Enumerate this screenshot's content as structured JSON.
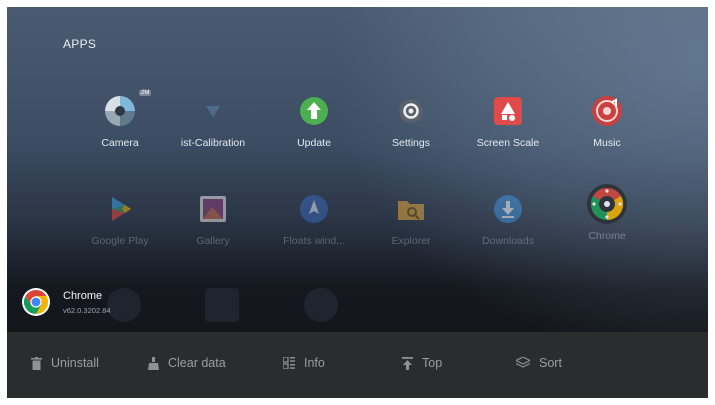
{
  "header": {
    "title": "APPS"
  },
  "apps": [
    {
      "label": "Camera",
      "badge": "2M",
      "icon": "camera-icon"
    },
    {
      "label": "ist-Calibration",
      "icon": "calibration-icon"
    },
    {
      "label": "Update",
      "icon": "update-icon"
    },
    {
      "label": "Settings",
      "icon": "settings-icon"
    },
    {
      "label": "Screen Scale",
      "icon": "screen-scale-icon"
    },
    {
      "label": "Music",
      "icon": "music-icon"
    },
    {
      "label": "Google Play",
      "icon": "play-store-icon"
    },
    {
      "label": "Gallery",
      "icon": "gallery-icon"
    },
    {
      "label": "Floats wind...",
      "icon": "float-window-icon"
    },
    {
      "label": "Explorer",
      "icon": "folder-icon"
    },
    {
      "label": "Downloads",
      "icon": "download-icon"
    },
    {
      "label": "Chrome",
      "icon": "chrome-icon"
    }
  ],
  "selected_app": {
    "name": "Chrome",
    "version": "v62.0.3202.84",
    "icon": "chrome-icon"
  },
  "actions": [
    {
      "label": "Uninstall",
      "icon": "trash-icon"
    },
    {
      "label": "Clear data",
      "icon": "broom-icon"
    },
    {
      "label": "Info",
      "icon": "info-grid-icon"
    },
    {
      "label": "Top",
      "icon": "pin-top-icon"
    },
    {
      "label": "Sort",
      "icon": "sort-layers-icon"
    }
  ],
  "colors": {
    "update_green": "#4caf50",
    "screen_scale_red": "#e04a4a",
    "music_red": "#c94040",
    "bar_bg": "#2b2c2e"
  }
}
